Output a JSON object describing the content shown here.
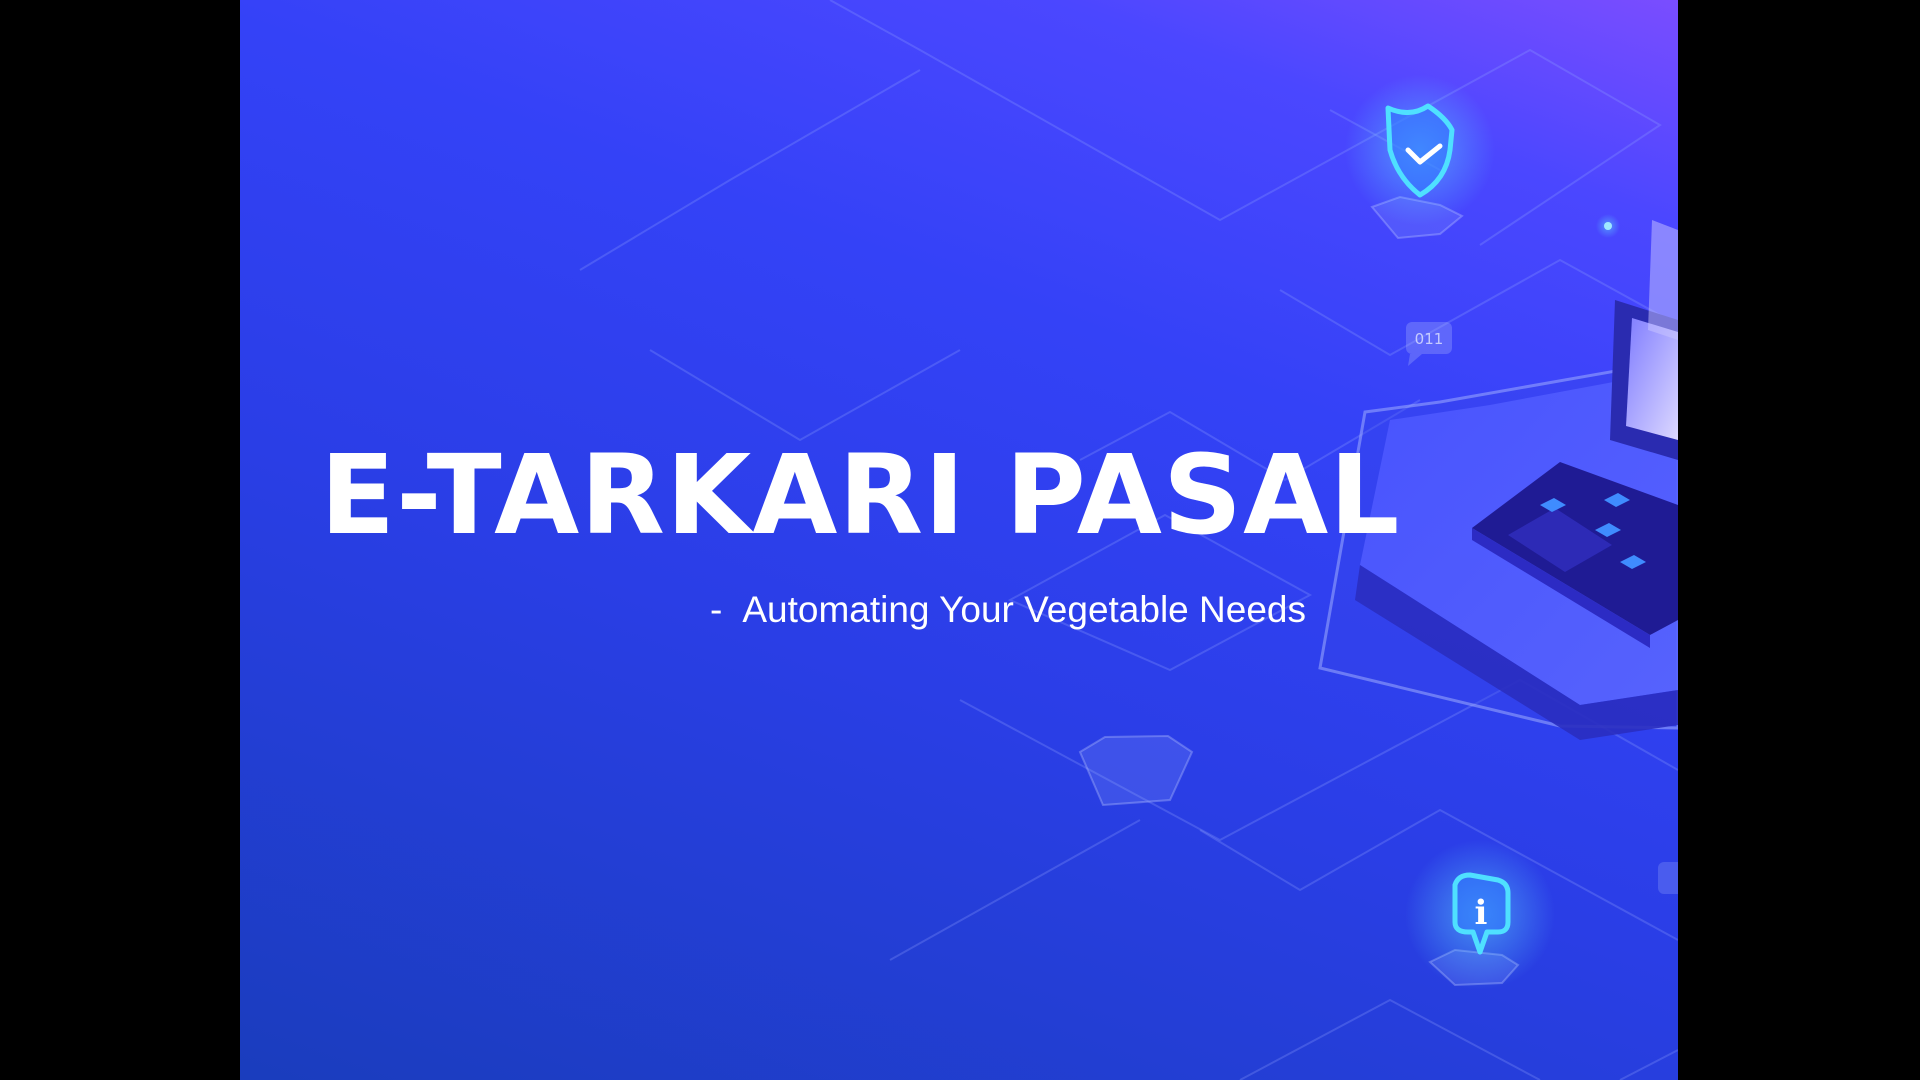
{
  "slide": {
    "title": "E-TARKARI PASAL",
    "subtitle_dash": "-",
    "subtitle": "Automating Your Vegetable Needs"
  },
  "decor": {
    "code_bubble_text": "011",
    "info_icon_text": "i"
  },
  "colors": {
    "background_top": "#7a4dff",
    "background_mid": "#3442f7",
    "background_bottom": "#1a3dbd",
    "text": "#ffffff",
    "icon_glow": "#49c6ff",
    "laptop_dark": "#231f9e",
    "laptop_key": "#3f8cff"
  },
  "icons": [
    "shield-check-icon",
    "info-bubble-icon",
    "code-bubble-icon",
    "laptop-illustration"
  ]
}
